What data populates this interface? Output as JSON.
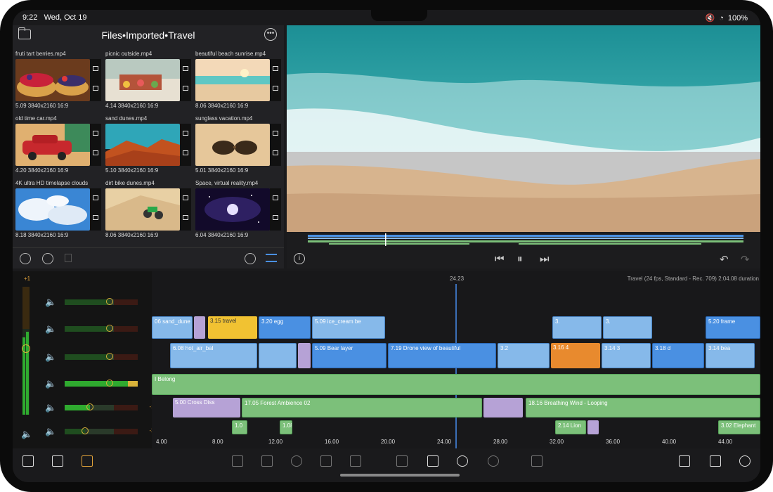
{
  "status": {
    "time": "9:22",
    "date": "Wed, Oct 19",
    "battery": "100%"
  },
  "browser": {
    "title": "Files•Imported•Travel",
    "clips": [
      {
        "name": "fruti tart berries.mp4",
        "meta": "5.09 3840x2160  16:9"
      },
      {
        "name": "picnic outside.mp4",
        "meta": "4.14 3840x2160  16:9"
      },
      {
        "name": "beautiful beach sunrise.mp4",
        "meta": "8.06 3840x2160  16:9"
      },
      {
        "name": "old time car.mp4",
        "meta": "4.20 3840x2160  16:9"
      },
      {
        "name": "sand dunes.mp4",
        "meta": "5.10 3840x2160  16:9"
      },
      {
        "name": "sunglass vacation.mp4",
        "meta": "5.01 3840x2160  16:9"
      },
      {
        "name": "4K ultra HD timelapse clouds",
        "meta": "8.18 3840x2160  16:9"
      },
      {
        "name": "dirt bike dunes.mp4",
        "meta": "8.06 3840x2160  16:9"
      },
      {
        "name": "Space, virtual reality.mp4",
        "meta": "6.04 3840x2160  16:9"
      }
    ]
  },
  "timeline": {
    "playhead_time": "24.23",
    "project_info": "Travel (24 fps, Standard - Rec. 709) 2:04.08 duration",
    "plus_label": "+1",
    "tracks_db": [
      "0",
      "0",
      "0",
      "0",
      "-15",
      "-20"
    ],
    "track_levels": [
      0.62,
      0.62,
      0.62,
      0.62,
      0.35,
      0.28
    ],
    "ruler": [
      "4.00",
      "8.00",
      "12.00",
      "16.00",
      "20.00",
      "24.00",
      "28.00",
      "32.00",
      "36.00",
      "40.00",
      "44.00"
    ],
    "clips": {
      "sand_dune": "06 sand_dune",
      "travel": "3.15 travel",
      "c320": "3.20 egg",
      "ice": "5.09 ice_cream be",
      "c3a": "3.",
      "c3b": "3.",
      "frame": "5.20 frame",
      "hot_air": "6.08 hot_air_bal",
      "bear": "5.09 Bear layer",
      "drone": "7.19 Drone view of beautiful",
      "c32": "3.2",
      "c316": "3.16 4",
      "c314": "3.14 3",
      "c318": "3.18 d",
      "c314b": "3.14 bea",
      "belong": "I Belong",
      "cross": "5.00 Cross Diss",
      "forest": "17.05 Forest Ambience 02",
      "wind": "18.16 Breathing Wind - Looping",
      "s10": "1.0",
      "s108": "1.08",
      "lion": "2.14 Lion",
      "elephant": "3.02 Elephant"
    }
  },
  "colors": {
    "accent": "#e0a23a",
    "playhead": "#3b6fb8",
    "video_clip": "#4a90e2",
    "audio_clip": "#7cc07a"
  }
}
